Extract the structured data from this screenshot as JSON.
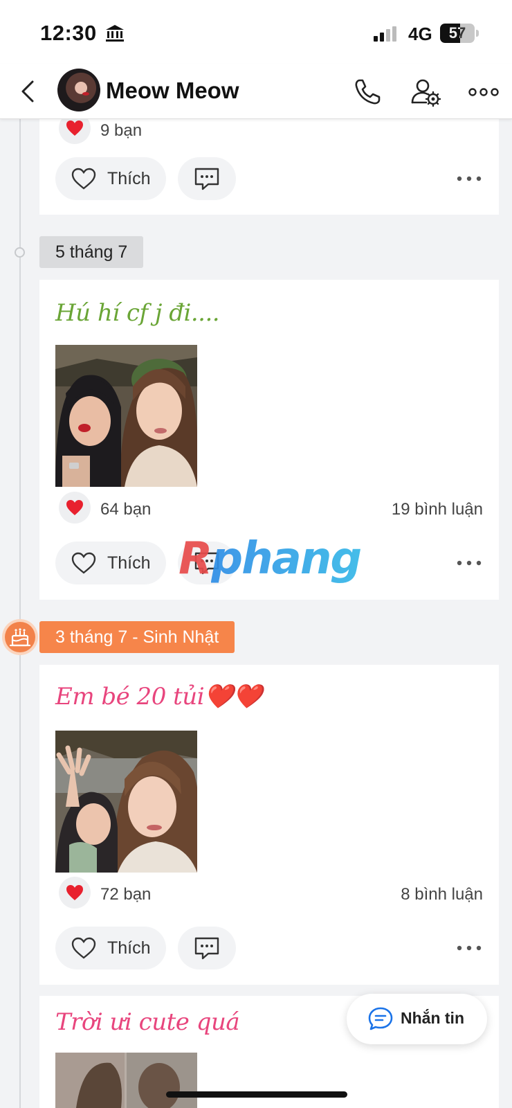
{
  "status_bar": {
    "time": "12:30",
    "network": "4G",
    "battery": "57",
    "battery_level": 0.57
  },
  "header": {
    "contact_name": "Meow Meow"
  },
  "posts": [
    {
      "likes": "9 bạn",
      "like_label": "Thích"
    },
    {
      "date": "5 tháng 7",
      "title": "Hú hí cf j đi....",
      "title_color": "#6aa536",
      "likes": "64 bạn",
      "comments": "19 bình luận",
      "like_label": "Thích"
    },
    {
      "date": "3 tháng 7 - Sinh Nhật",
      "title": "Em bé 20 tủi❤️❤️",
      "title_color": "#e8457d",
      "likes": "72 bạn",
      "comments": "8 bình luận",
      "like_label": "Thích"
    },
    {
      "title": "Trời ưi cute quá",
      "title_color": "#e8457d"
    }
  ],
  "watermark": {
    "first": "R",
    "rest": "phang"
  },
  "message_button": {
    "label": "Nhắn tin"
  },
  "colors": {
    "accent_orange": "#f6854a",
    "heart_red": "#e8212e",
    "link_blue": "#1a73e8"
  }
}
